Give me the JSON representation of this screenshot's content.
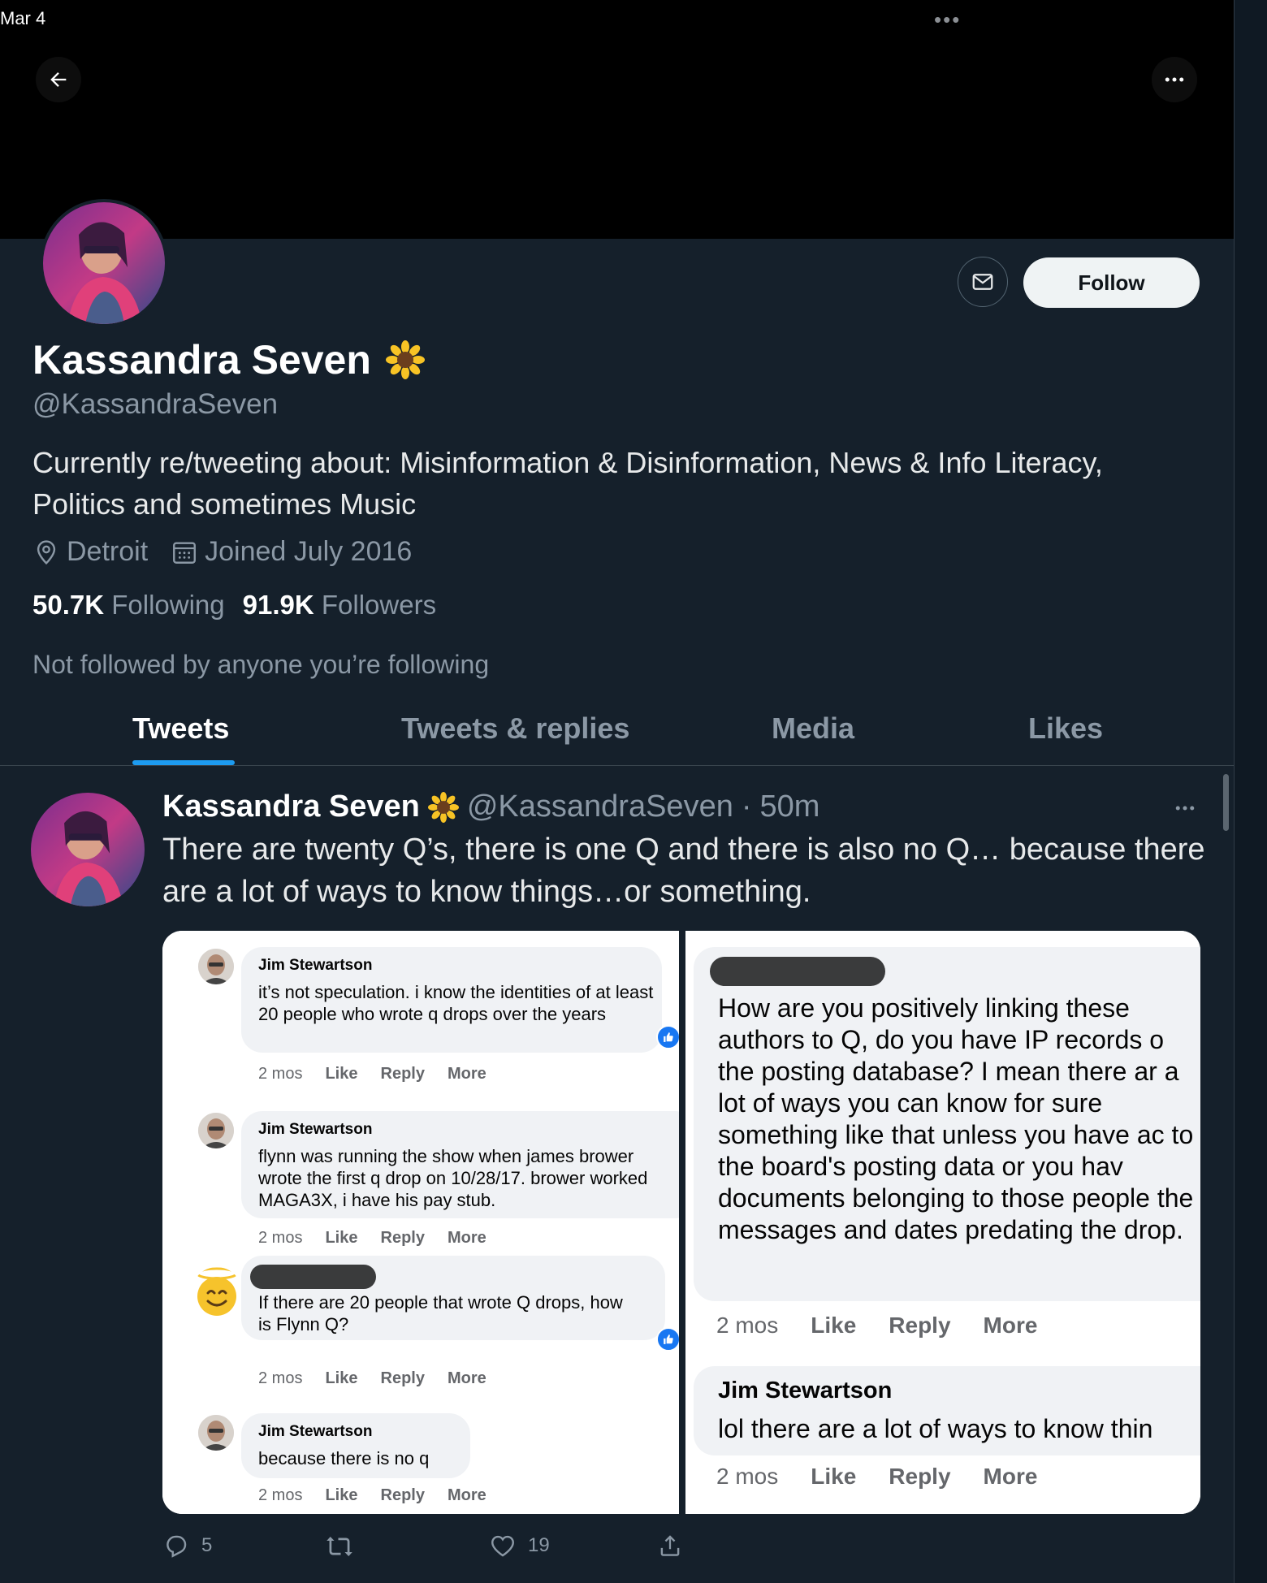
{
  "status_bar": {
    "time": "Mar 4",
    "dots": "•••"
  },
  "profile": {
    "display_name": "Kassandra Seven",
    "handle": "@KassandraSeven",
    "follow_label": "Follow",
    "bio": "Currently re/tweeting about: Misinformation & Disinformation, News & Info Literacy, Politics and sometimes Music",
    "location": "Detroit",
    "joined": "Joined July 2016",
    "following_count": "50.7K",
    "following_label": "Following",
    "followers_count": "91.9K",
    "followers_label": "Followers",
    "not_followed": "Not followed by anyone you’re following"
  },
  "tabs": [
    "Tweets",
    "Tweets & replies",
    "Media",
    "Likes"
  ],
  "tweet": {
    "name": "Kassandra Seven",
    "handle": "@KassandraSeven",
    "separator": "·",
    "time": "50m",
    "text": "There are twenty Q’s, there is one Q and there is also no Q… because there are a lot of ways to know things…or something.",
    "replies": "5",
    "likes": "19",
    "media": {
      "left_comments": [
        {
          "name": "Jim Stewartson",
          "text": "it’s not speculation. i know the identities of at least 20 people who wrote q drops over the years",
          "time": "2 mos",
          "like": "Like",
          "reply": "Reply",
          "more": "More"
        },
        {
          "name": "Jim Stewartson",
          "text": "flynn was running the show when james brower wrote the first q drop on 10/28/17. brower worked MAGA3X, i have his pay stub.",
          "time": "2 mos",
          "like": "Like",
          "reply": "Reply",
          "more": "More"
        },
        {
          "name": "",
          "text": "If there are 20 people that wrote Q drops, how is Flynn Q?",
          "time": "2 mos",
          "like": "Like",
          "reply": "Reply",
          "more": "More"
        },
        {
          "name": "Jim Stewartson",
          "text": "because there is no q",
          "time": "2 mos",
          "like": "Like",
          "reply": "Reply",
          "more": "More"
        }
      ],
      "right_comments": [
        {
          "name": "",
          "text": "How are you positively linking these authors to Q, do you have IP records o the posting database? I mean there ar a lot of ways you can know for sure something like that unless you have ac to the board's posting data or you hav documents belonging to those people the messages and dates predating the drop.",
          "time": "2 mos",
          "like": "Like",
          "reply": "Reply",
          "more": "More"
        },
        {
          "name": "Jim Stewartson",
          "text": "lol there are a lot of ways to know thin",
          "time": "2 mos",
          "like": "Like",
          "reply": "Reply",
          "more": "More"
        }
      ]
    }
  },
  "colors": {
    "bg": "#15202b",
    "accent": "#1d9bf0",
    "muted": "#8b98a5",
    "fb_like": "#1877f2"
  },
  "icons": [
    "back-arrow-icon",
    "more-icon",
    "mail-icon",
    "sunflower-icon",
    "location-pin-icon",
    "calendar-icon",
    "reply-icon",
    "retweet-icon",
    "heart-icon",
    "share-icon",
    "thumbs-up-icon",
    "halo-smile-icon"
  ]
}
